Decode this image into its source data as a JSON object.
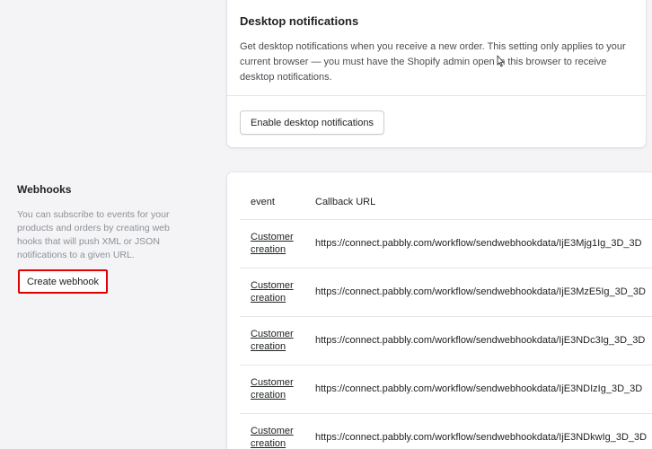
{
  "desktop_notifications": {
    "title": "Desktop notifications",
    "description": "Get desktop notifications when you receive a new order. This setting only applies to your current browser — you must have the Shopify admin open in this browser to receive desktop notifications.",
    "button_label": "Enable desktop notifications"
  },
  "webhooks": {
    "title": "Webhooks",
    "description": "You can subscribe to events for your products and orders by creating web hooks that will push XML or JSON notifications to a given URL.",
    "create_button_label": "Create webhook",
    "table": {
      "headers": [
        "event",
        "Callback URL"
      ],
      "rows": [
        {
          "event": "Customer creation",
          "url": "https://connect.pabbly.com/workflow/sendwebhookdata/IjE3Mjg1Ig_3D_3D"
        },
        {
          "event": "Customer creation",
          "url": "https://connect.pabbly.com/workflow/sendwebhookdata/IjE3MzE5Ig_3D_3D"
        },
        {
          "event": "Customer creation",
          "url": "https://connect.pabbly.com/workflow/sendwebhookdata/IjE3NDc3Ig_3D_3D"
        },
        {
          "event": "Customer creation",
          "url": "https://connect.pabbly.com/workflow/sendwebhookdata/IjE3NDIzIg_3D_3D"
        },
        {
          "event": "Customer creation",
          "url": "https://connect.pabbly.com/workflow/sendwebhookdata/IjE3NDkwIg_3D_3D"
        }
      ]
    }
  },
  "colors": {
    "background": "#f4f4f7",
    "card": "#ffffff",
    "highlight_border": "#e00000"
  }
}
